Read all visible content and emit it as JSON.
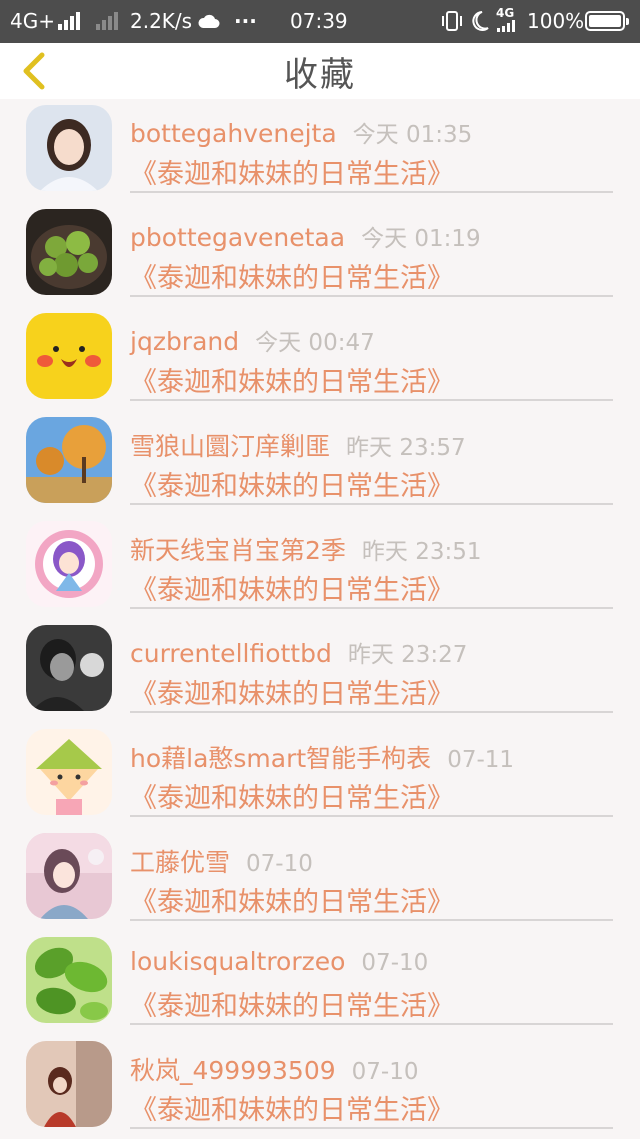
{
  "status_bar": {
    "network": "4G+",
    "speed": "2.2K/s",
    "more": "···",
    "time": "07:39",
    "net2": "4G",
    "battery": "100%"
  },
  "header": {
    "title": "收藏"
  },
  "items": [
    {
      "name": "bottegahvenejta",
      "time": "今天 01:35",
      "work": "《泰迦和妹妹的日常生活》"
    },
    {
      "name": "pbottegavenetaa",
      "time": "今天 01:19",
      "work": "《泰迦和妹妹的日常生活》"
    },
    {
      "name": "jqzbrand",
      "time": "今天 00:47",
      "work": "《泰迦和妹妹的日常生活》"
    },
    {
      "name": "雪狼山圜汀庠剿匪",
      "time": "昨天 23:57",
      "work": "《泰迦和妹妹的日常生活》"
    },
    {
      "name": "新天线宝肖宝第2季",
      "time": "昨天 23:51",
      "work": "《泰迦和妹妹的日常生活》"
    },
    {
      "name": "currentellfiottbd",
      "time": "昨天 23:27",
      "work": "《泰迦和妹妹的日常生活》"
    },
    {
      "name": "ho藉la憨smart智能手枸表",
      "time": "07-11",
      "work": "《泰迦和妹妹的日常生活》"
    },
    {
      "name": "工藤优雪",
      "time": "07-10",
      "work": "《泰迦和妹妹的日常生活》"
    },
    {
      "name": "loukisqualtrorzeo",
      "time": "07-10",
      "work": "《泰迦和妹妹的日常生活》"
    },
    {
      "name": "秋岚_499993509",
      "time": "07-10",
      "work": "《泰迦和妹妹的日常生活》"
    }
  ],
  "colors": {
    "accent": "#e8916a",
    "timestamp": "#c5c0bc",
    "status_bar": "#4d4d4d",
    "back_arrow": "#e0c020"
  }
}
